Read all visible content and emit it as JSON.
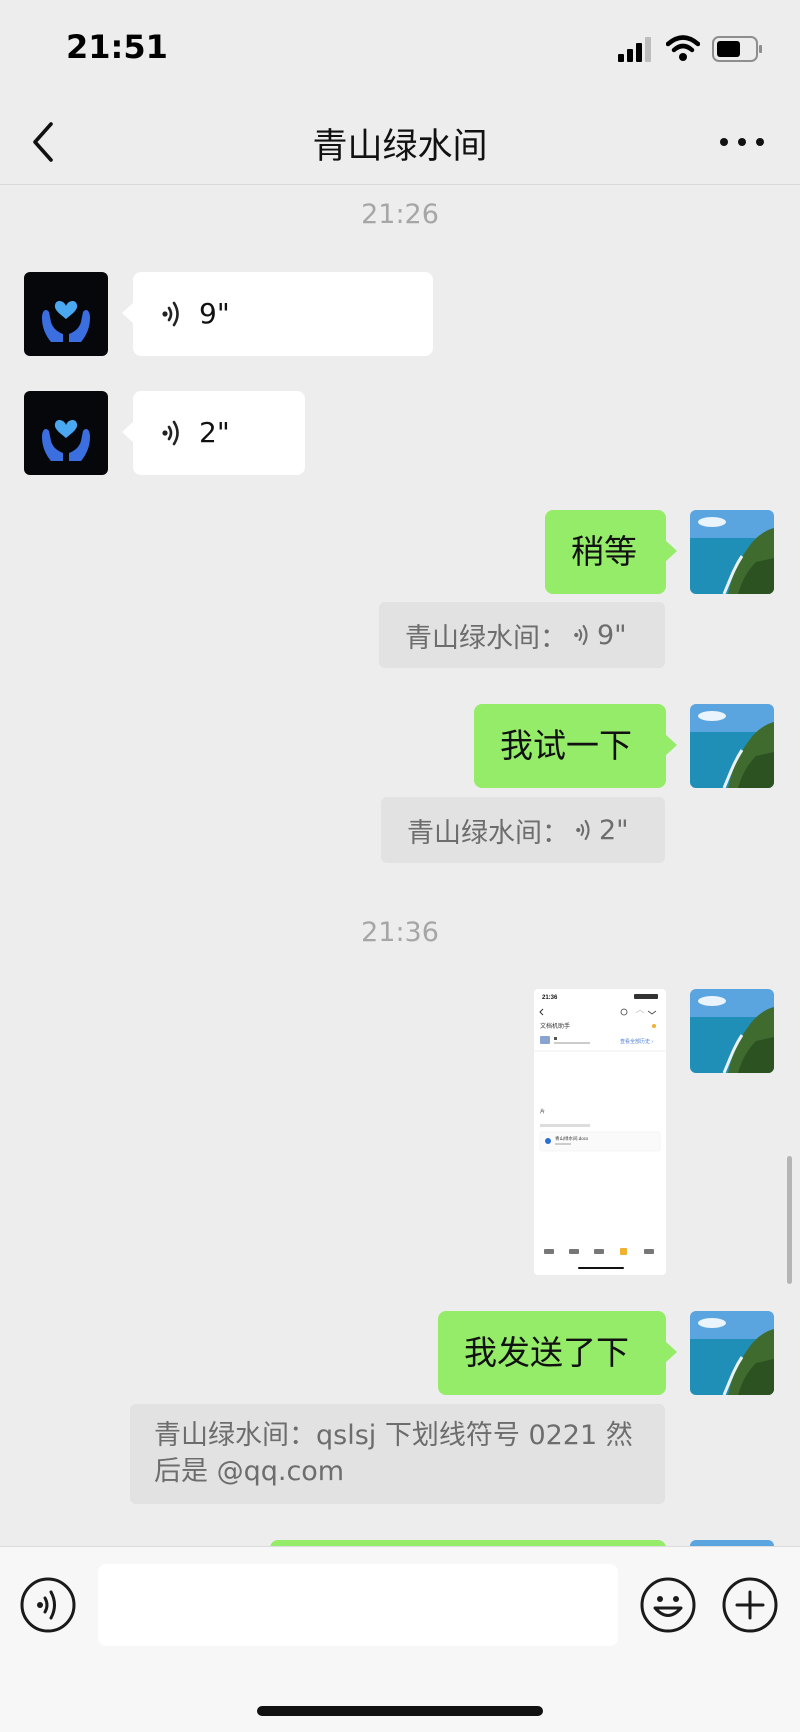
{
  "status_bar": {
    "time": "21:51"
  },
  "nav": {
    "title": "青山绿水间"
  },
  "timestamps": [
    "21:26",
    "21:36"
  ],
  "messages": {
    "voice1_duration": "9\"",
    "voice2_duration": "2\"",
    "reply1": "稍等",
    "quote1_sender": "青山绿水间：",
    "quote1_duration": "9\"",
    "reply2": "我试一下",
    "quote2_sender": "青山绿水间：",
    "quote2_duration": "2\"",
    "reply3": "我发送了下",
    "quote3_text": "青山绿水间：qslsj 下划线符号 0221 然后是 @qq.com"
  },
  "screenshot_thumb": {
    "time": "21:36",
    "title": "文档机助手",
    "link": "查看全部历史 ›",
    "section": "片",
    "file_name": "青山绿水间.docx"
  },
  "colors": {
    "background": "#ededed",
    "outgoing_bubble": "#95ec69",
    "incoming_bubble": "#ffffff",
    "avatar_hands": "#3b6fe0",
    "avatar_heart": "#4aa8f0"
  },
  "icons": [
    "back-icon",
    "more-icon",
    "voice-icon",
    "emoji-icon",
    "plus-icon",
    "signal-icon",
    "wifi-icon",
    "battery-icon"
  ]
}
